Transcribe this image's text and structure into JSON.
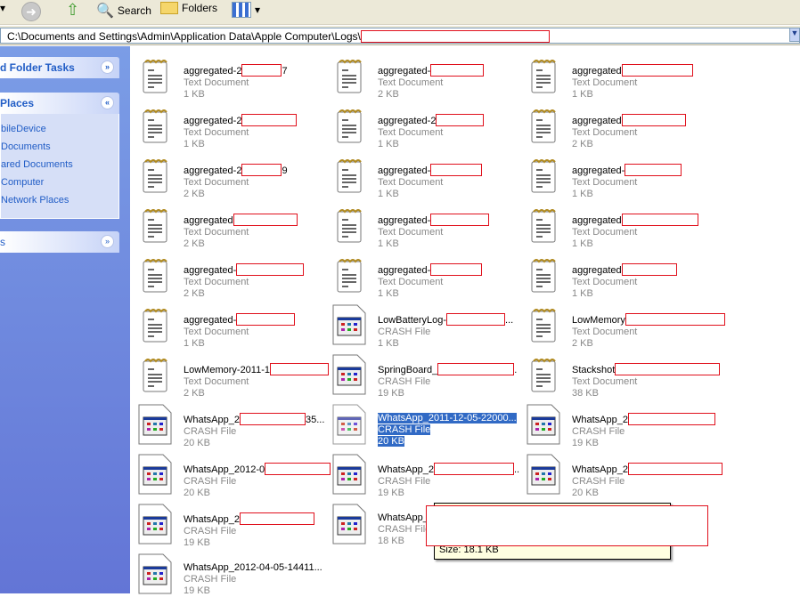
{
  "toolbar": {
    "search_label": "Search",
    "folders_label": "Folders"
  },
  "address": {
    "path": "C:\\Documents and Settings\\Admin\\Application Data\\Apple Computer\\Logs\\"
  },
  "sidebar": {
    "tasks_title": "d Folder Tasks",
    "places_title": "Places",
    "places": [
      "bileDevice",
      " Documents",
      "ared Documents",
      " Computer",
      " Network Places"
    ],
    "details_title": "s"
  },
  "files": [
    [
      {
        "name": "aggregated-2",
        "after": "7",
        "type": "Text Document",
        "size": "1 KB",
        "red": 45
      },
      {
        "name": "aggregated-2",
        "after": "",
        "type": "Text Document",
        "size": "1 KB",
        "red": 62
      },
      {
        "name": "aggregated-2",
        "after": "9",
        "type": "Text Document",
        "size": "2 KB",
        "red": 45
      },
      {
        "name": "aggregated",
        "after": "",
        "type": "Text Document",
        "size": "2 KB",
        "red": 72
      },
      {
        "name": "aggregated-",
        "after": "",
        "type": "Text Document",
        "size": "2 KB",
        "red": 76
      },
      {
        "name": "aggregated-",
        "after": "",
        "type": "Text Document",
        "size": "1 KB",
        "red": 66
      },
      {
        "name": "LowMemory-2011-1",
        "after": "",
        "type": "Text Document",
        "size": "2 KB",
        "red": 66
      },
      {
        "name": "WhatsApp_2",
        "after": "35...",
        "type": "CRASH File",
        "size": "20 KB",
        "red": 74
      },
      {
        "name": "WhatsApp_2012-0",
        "after": "",
        "type": "CRASH File",
        "size": "20 KB",
        "red": 74
      },
      {
        "name": "WhatsApp_2",
        "after": "",
        "type": "CRASH File",
        "size": "19 KB",
        "red": 84
      },
      {
        "name": "WhatsApp_2012-04-05-14411...",
        "after": "",
        "type": "CRASH File",
        "size": "19 KB",
        "red": 0
      }
    ],
    [
      {
        "name": "aggregated-",
        "after": "",
        "type": "Text Document",
        "size": "2 KB",
        "red": 60
      },
      {
        "name": "aggregated-2",
        "after": "",
        "type": "Text Document",
        "size": "1 KB",
        "red": 54
      },
      {
        "name": "aggregated-",
        "after": "",
        "type": "Text Document",
        "size": "1 KB",
        "red": 58
      },
      {
        "name": "aggregated-",
        "after": "",
        "type": "Text Document",
        "size": "1 KB",
        "red": 66
      },
      {
        "name": "aggregated-",
        "after": "",
        "type": "Text Document",
        "size": "1 KB",
        "red": 58
      },
      {
        "name": "LowBatteryLog-",
        "after": "...",
        "type": "CRASH File",
        "size": "1 KB",
        "red": 66
      },
      {
        "name": "SpringBoard_",
        "after": ".",
        "type": "CRASH File",
        "size": "19 KB",
        "red": 86
      },
      {
        "name": "WhatsApp_2011-12-05-22000...",
        "after": "",
        "type": "CRASH File",
        "size": "20 KB",
        "red": 0,
        "selected": true
      },
      {
        "name": "WhatsApp_2",
        "after": "..",
        "type": "CRASH File",
        "size": "19 KB",
        "red": 90
      },
      {
        "name": "WhatsApp_",
        "after": "",
        "type": "CRASH File",
        "size": "18 KB",
        "red": 0
      }
    ],
    [
      {
        "name": "aggregated",
        "after": "",
        "type": "Text Document",
        "size": "1 KB",
        "red": 80
      },
      {
        "name": "aggregated",
        "after": "",
        "type": "Text Document",
        "size": "2 KB",
        "red": 72
      },
      {
        "name": "aggregated-",
        "after": "",
        "type": "Text Document",
        "size": "1 KB",
        "red": 64
      },
      {
        "name": "aggregated",
        "after": "",
        "type": "Text Document",
        "size": "1 KB",
        "red": 86
      },
      {
        "name": "aggregated",
        "after": "",
        "type": "Text Document",
        "size": "1 KB",
        "red": 62
      },
      {
        "name": "LowMemory",
        "after": "",
        "type": "Text Document",
        "size": "2 KB",
        "red": 112
      },
      {
        "name": "Stackshot",
        "after": "",
        "type": "Text Document",
        "size": "38 KB",
        "red": 118
      },
      {
        "name": "WhatsApp_2",
        "after": "",
        "type": "CRASH File",
        "size": "19 KB",
        "red": 98
      },
      {
        "name": "WhatsApp_2",
        "after": "",
        "type": "CRASH File",
        "size": "20 KB",
        "red": 106
      }
    ]
  ],
  "tooltip": {
    "size_text": "Size: 18.1 KB"
  }
}
